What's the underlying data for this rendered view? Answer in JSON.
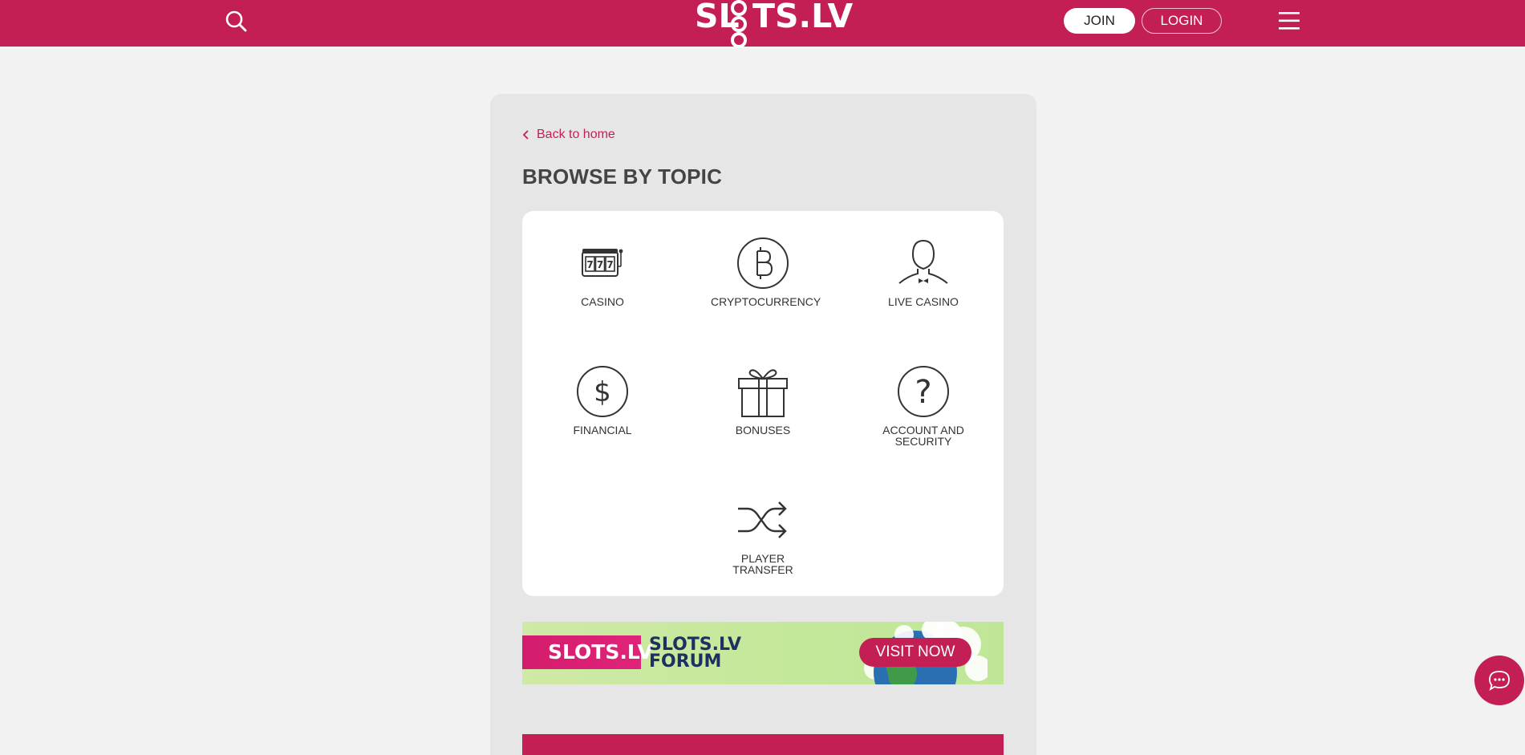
{
  "header": {
    "logo_left": "SL",
    "logo_right": "TS.LV",
    "join_label": "JOIN",
    "login_label": "LOGIN",
    "search_icon": "search-icon",
    "menu_icon": "hamburger-menu-icon"
  },
  "colors": {
    "brand": "#c41f55",
    "page_bg": "#f2f2f2",
    "panel_bg": "#e6e6e6"
  },
  "main": {
    "back_label": "Back to home",
    "title": "BROWSE BY TOPIC",
    "topics": [
      {
        "label": "CASINO",
        "icon": "slot-machine-icon"
      },
      {
        "label": "CRYPTOCURRENCY",
        "icon": "bitcoin-icon"
      },
      {
        "label": "LIVE CASINO",
        "icon": "dealer-icon"
      },
      {
        "label": "FINANCIAL",
        "icon": "dollar-icon"
      },
      {
        "label": "BONUSES",
        "icon": "gift-icon"
      },
      {
        "label": "ACCOUNT AND SECURITY",
        "icon": "question-icon"
      },
      {
        "label": "PLAYER TRANSFER",
        "icon": "shuffle-icon"
      }
    ]
  },
  "banner": {
    "brand": "SLOTS.LV",
    "forum_line1": "SLOTS.LV",
    "forum_line2": "FORUM",
    "cta": "VISIT NOW"
  },
  "chat": {
    "icon": "chat-bubble-icon"
  }
}
